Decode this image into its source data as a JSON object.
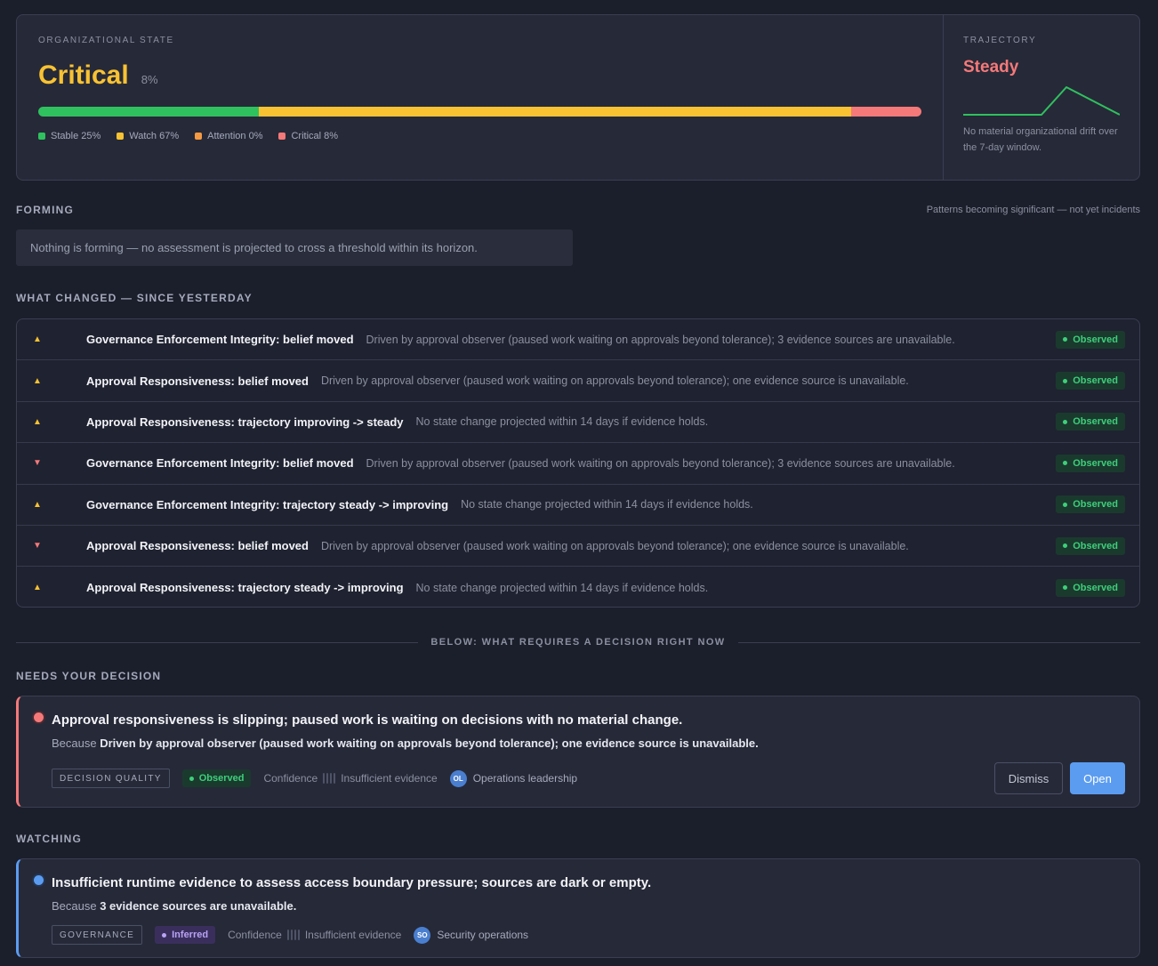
{
  "state": {
    "overline": "ORGANIZATIONAL STATE",
    "label": "Critical",
    "percent": "8%",
    "bar": [
      {
        "name": "Stable",
        "fraction": 0.25,
        "color": "#2fc15e"
      },
      {
        "name": "Watch",
        "fraction": 0.67,
        "color": "#f8c232"
      },
      {
        "name": "Attention",
        "fraction": 0.0,
        "color": "#f59a42"
      },
      {
        "name": "Critical",
        "fraction": 0.08,
        "color": "#f57979"
      }
    ],
    "legend": [
      {
        "label": "Stable 25%",
        "color": "#2fc15e"
      },
      {
        "label": "Watch 67%",
        "color": "#f8c232"
      },
      {
        "label": "Attention 0%",
        "color": "#f59a42"
      },
      {
        "label": "Critical 8%",
        "color": "#f57979"
      }
    ]
  },
  "trajectory": {
    "overline": "TRAJECTORY",
    "label": "Steady",
    "note": "No material organizational drift over the 7-day window.",
    "spark_color": "#2fc15e"
  },
  "forming": {
    "title": "FORMING",
    "subtitle": "Patterns becoming significant — not yet incidents",
    "empty": "Nothing is forming — no assessment is projected to cross a threshold within its horizon."
  },
  "changed": {
    "title": "WHAT CHANGED — SINCE YESTERDAY",
    "rows": [
      {
        "dir": "up",
        "arrow": "▲",
        "title": "Governance Enforcement Integrity: belief moved",
        "desc": "Driven by approval observer (paused work waiting on approvals beyond tolerance); 3 evidence sources are unavailable.",
        "badge": "Observed"
      },
      {
        "dir": "up",
        "arrow": "▲",
        "title": "Approval Responsiveness: belief moved",
        "desc": "Driven by approval observer (paused work waiting on approvals beyond tolerance); one evidence source is unavailable.",
        "badge": "Observed"
      },
      {
        "dir": "up",
        "arrow": "▲",
        "title": "Approval Responsiveness: trajectory improving -> steady",
        "desc": "No state change projected within 14 days if evidence holds.",
        "badge": "Observed"
      },
      {
        "dir": "down",
        "arrow": "▼",
        "title": "Governance Enforcement Integrity: belief moved",
        "desc": "Driven by approval observer (paused work waiting on approvals beyond tolerance); 3 evidence sources are unavailable.",
        "badge": "Observed"
      },
      {
        "dir": "up",
        "arrow": "▲",
        "title": "Governance Enforcement Integrity: trajectory steady -> improving",
        "desc": "No state change projected within 14 days if evidence holds.",
        "badge": "Observed"
      },
      {
        "dir": "down",
        "arrow": "▼",
        "title": "Approval Responsiveness: belief moved",
        "desc": "Driven by approval observer (paused work waiting on approvals beyond tolerance); one evidence source is unavailable.",
        "badge": "Observed"
      },
      {
        "dir": "up",
        "arrow": "▲",
        "title": "Approval Responsiveness: trajectory steady -> improving",
        "desc": "No state change projected within 14 days if evidence holds.",
        "badge": "Observed"
      }
    ]
  },
  "divider": "BELOW: WHAT REQUIRES A DECISION RIGHT NOW",
  "needs": {
    "title": "NEEDS YOUR DECISION",
    "card": {
      "title": "Approval responsiveness is slipping; paused work is waiting on decisions with no material change.",
      "because_prefix": "Because",
      "because": "Driven by approval observer (paused work waiting on approvals beyond tolerance); one evidence source is unavailable.",
      "tag": "DECISION QUALITY",
      "badge": "Observed",
      "confidence_label": "Confidence",
      "confidence_text": "Insufficient evidence",
      "owner_initials": "OL",
      "owner": "Operations leadership",
      "dismiss": "Dismiss",
      "open": "Open"
    }
  },
  "watching": {
    "title": "WATCHING",
    "card": {
      "title": "Insufficient runtime evidence to assess access boundary pressure; sources are dark or empty.",
      "because_prefix": "Because",
      "because": "3 evidence sources are unavailable.",
      "tag": "GOVERNANCE",
      "badge": "Inferred",
      "confidence_label": "Confidence",
      "confidence_text": "Insufficient evidence",
      "owner_initials": "SO",
      "owner": "Security operations"
    }
  }
}
